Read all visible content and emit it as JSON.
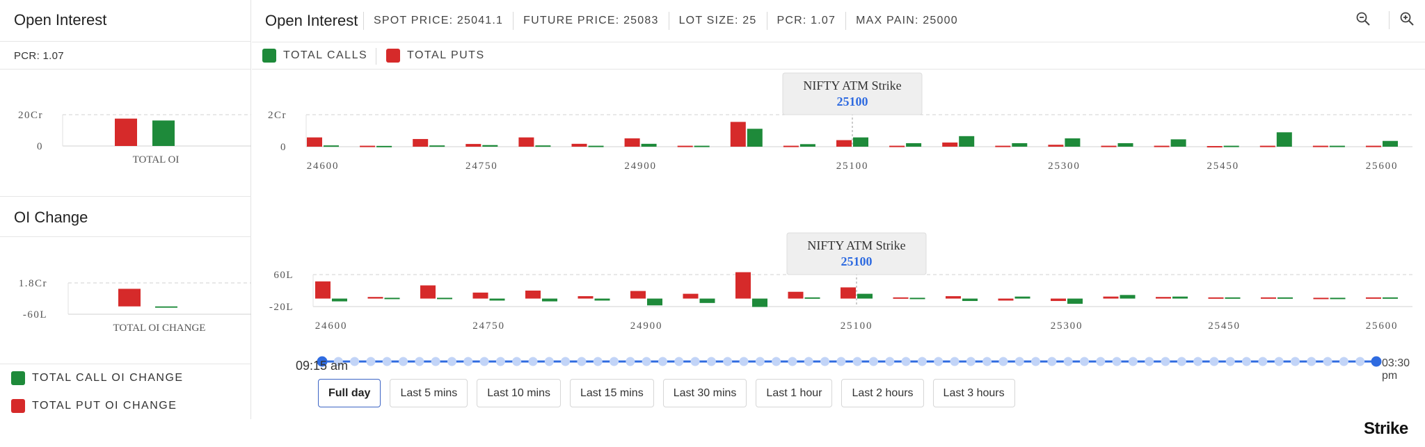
{
  "left_panel": {
    "oi_title": "Open Interest",
    "pcr_text": "PCR: 1.07",
    "oi_change_title": "OI Change",
    "legend": [
      {
        "label": "TOTAL CALL OI CHANGE",
        "color": "#1e8a3a"
      },
      {
        "label": "TOTAL PUT OI CHANGE",
        "color": "#d62a2a"
      }
    ]
  },
  "header": {
    "title": "Open Interest",
    "items": [
      "SPOT PRICE: 25041.1",
      "FUTURE PRICE: 25083",
      "LOT SIZE: 25",
      "PCR: 1.07",
      "MAX PAIN: 25000"
    ],
    "zoom_out_icon": "zoom-out-icon",
    "zoom_in_icon": "zoom-in-icon"
  },
  "legend": {
    "calls": {
      "label": "TOTAL CALLS",
      "color": "#1e8a3a"
    },
    "puts": {
      "label": "TOTAL PUTS",
      "color": "#d62a2a"
    }
  },
  "colors": {
    "call": "#1e8a3a",
    "put": "#d62a2a",
    "accent": "#2f6be0",
    "slider_dot": "#c2d4f7"
  },
  "time_slider": {
    "start_label": "09:15 am",
    "end_label": "03:30 pm"
  },
  "time_buttons": [
    {
      "label": "Full day",
      "active": true
    },
    {
      "label": "Last 5 mins",
      "active": false
    },
    {
      "label": "Last 10 mins",
      "active": false
    },
    {
      "label": "Last 15 mins",
      "active": false
    },
    {
      "label": "Last 30 mins",
      "active": false
    },
    {
      "label": "Last 1 hour",
      "active": false
    },
    {
      "label": "Last 2 hours",
      "active": false
    },
    {
      "label": "Last 3 hours",
      "active": false
    }
  ],
  "brand": {
    "text": "Strike"
  },
  "chart_data": [
    {
      "id": "total_oi",
      "type": "bar",
      "categories": [
        "TOTAL OI"
      ],
      "xlabel": "TOTAL OI",
      "series": [
        {
          "role": "puts",
          "values": [
            17.5
          ]
        },
        {
          "role": "calls",
          "values": [
            16.3
          ]
        }
      ],
      "unit": "Cr",
      "yticks": [
        {
          "value": 0,
          "label": "0"
        },
        {
          "value": 20,
          "label": "20Cr"
        }
      ],
      "ylim": [
        0,
        20
      ],
      "grid": true
    },
    {
      "id": "total_oi_change",
      "type": "bar",
      "categories": [
        "TOTAL OI CHANGE"
      ],
      "xlabel": "TOTAL OI CHANGE",
      "series": [
        {
          "role": "puts",
          "values": [
            1.35
          ]
        },
        {
          "role": "calls",
          "values": [
            -0.1
          ]
        }
      ],
      "unit": "Cr",
      "yticks": [
        {
          "value": -0.6,
          "label": "-60L"
        },
        {
          "value": 1.8,
          "label": "1.8Cr"
        }
      ],
      "ylim": [
        -0.6,
        1.8
      ],
      "grid": true
    },
    {
      "id": "oi_by_strike",
      "type": "bar",
      "x": [
        24600,
        24650,
        24700,
        24750,
        24800,
        24850,
        24900,
        24950,
        25000,
        25050,
        25100,
        25150,
        25200,
        25250,
        25300,
        25350,
        25400,
        25450,
        25500,
        25550,
        25600
      ],
      "xtick_labels": [
        "24600",
        "24750",
        "24900",
        "25100",
        "25300",
        "25450",
        "25600"
      ],
      "series": [
        {
          "name": "TOTAL PUTS",
          "values": [
            0.58,
            0.06,
            0.48,
            0.17,
            0.58,
            0.18,
            0.52,
            0.06,
            1.55,
            0.06,
            0.41,
            0.06,
            0.26,
            0.06,
            0.12,
            0.06,
            0.06,
            0.04,
            0.06,
            0.06,
            0.06
          ]
        },
        {
          "name": "TOTAL CALLS",
          "values": [
            0.08,
            0.05,
            0.08,
            0.1,
            0.08,
            0.06,
            0.18,
            0.06,
            1.12,
            0.16,
            0.58,
            0.22,
            0.66,
            0.22,
            0.52,
            0.22,
            0.46,
            0.06,
            0.9,
            0.06,
            0.36
          ]
        }
      ],
      "unit": "Cr",
      "yticks": [
        {
          "value": 0,
          "label": "0"
        },
        {
          "value": 2,
          "label": "2Cr"
        }
      ],
      "ylim": [
        0,
        2
      ],
      "annotation": {
        "title": "NIFTY ATM Strike",
        "value": "25100",
        "x": 25100
      },
      "grid": true
    },
    {
      "id": "oi_change_by_strike",
      "type": "bar",
      "x": [
        24600,
        24650,
        24700,
        24750,
        24800,
        24850,
        24900,
        24950,
        25000,
        25050,
        25100,
        25150,
        25200,
        25250,
        25300,
        25350,
        25400,
        25450,
        25500,
        25550,
        25600
      ],
      "xtick_labels": [
        "24600",
        "24750",
        "24900",
        "25100",
        "25300",
        "25450",
        "25600"
      ],
      "series": [
        {
          "name": "TOTAL PUT OI CHANGE",
          "values": [
            43,
            4,
            33,
            15,
            20,
            6,
            19,
            12,
            66,
            17,
            28,
            3,
            6,
            -5,
            -6,
            5,
            4,
            3,
            3,
            2,
            3
          ]
        },
        {
          "name": "TOTAL CALL OI CHANGE",
          "values": [
            -7,
            2,
            2,
            -5,
            -7,
            -5,
            -17,
            -11,
            -21,
            3,
            12,
            2,
            -6,
            5,
            -13,
            9,
            5,
            3,
            3,
            2,
            3
          ]
        }
      ],
      "unit": "L",
      "yticks": [
        {
          "value": -20,
          "label": "-20L"
        },
        {
          "value": 60,
          "label": "60L"
        }
      ],
      "ylim": [
        -20,
        60
      ],
      "annotation": {
        "title": "NIFTY ATM Strike",
        "value": "25100",
        "x": 25100
      },
      "grid": true
    }
  ]
}
